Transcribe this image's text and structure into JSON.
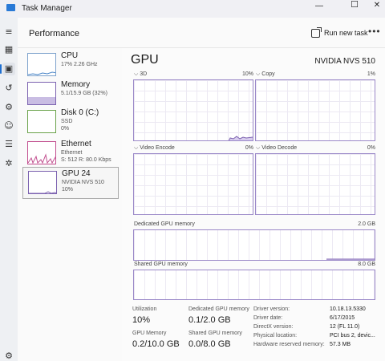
{
  "window": {
    "title": "Task Manager",
    "minimize": "—",
    "maximize": "☐",
    "close": "✕"
  },
  "header": {
    "page": "Performance",
    "run_task": "Run new task",
    "more": "•••"
  },
  "rail": {
    "menu": "≡",
    "processes": "▦",
    "performance": "▣",
    "history": "↺",
    "startup": "⚙",
    "users": "☺",
    "details": "☰",
    "services": "✲",
    "settings": "⚙"
  },
  "resources": [
    {
      "title": "CPU",
      "sub": [
        "17%  2.26 GHz"
      ]
    },
    {
      "title": "Memory",
      "sub": [
        "5.1/15.9 GB (32%)"
      ]
    },
    {
      "title": "Disk 0 (C:)",
      "sub": [
        "SSD",
        "0%"
      ]
    },
    {
      "title": "Ethernet",
      "sub": [
        "Ethernet",
        "S: 512  R: 80.0 Kbps"
      ]
    },
    {
      "title": "GPU 24",
      "sub": [
        "NVIDIA NVS 510",
        "10%"
      ]
    }
  ],
  "gpu": {
    "title": "GPU",
    "model": "NVIDIA NVS 510",
    "engines": [
      {
        "label": "3D",
        "pct": "10%"
      },
      {
        "label": "Copy",
        "pct": "1%"
      },
      {
        "label": "Video Encode",
        "pct": "0%"
      },
      {
        "label": "Video Decode",
        "pct": "0%"
      }
    ],
    "dedicated": {
      "label": "Dedicated GPU memory",
      "max": "2.0 GB"
    },
    "shared": {
      "label": "Shared GPU memory",
      "max": "8.0 GB"
    }
  },
  "stats": {
    "utilization": {
      "label": "Utilization",
      "value": "10%"
    },
    "dedicated": {
      "label": "Dedicated GPU memory",
      "value": "0.1/2.0 GB"
    },
    "gpu_memory": {
      "label": "GPU Memory",
      "value": "0.2/10.0 GB"
    },
    "shared": {
      "label": "Shared GPU memory",
      "value": "0.0/8.0 GB"
    }
  },
  "properties": [
    {
      "key": "Driver version:",
      "value": "10.18.13.5330"
    },
    {
      "key": "Driver date:",
      "value": "6/17/2015"
    },
    {
      "key": "DirectX version:",
      "value": "12 (FL 11.0)"
    },
    {
      "key": "Physical location:",
      "value": "PCI bus 2, devic..."
    },
    {
      "key": "Hardware reserved memory:",
      "value": "57.3 MB"
    }
  ]
}
